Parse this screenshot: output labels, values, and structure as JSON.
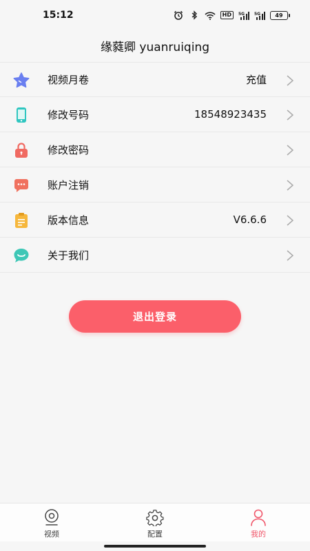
{
  "status_bar": {
    "time": "15:12",
    "icons": [
      "alarm-icon",
      "bluetooth-icon",
      "wifi-icon",
      "hd-icon",
      "signal-5g-icon",
      "signal-5g-icon-2",
      "battery-icon"
    ],
    "hd_label": "HD",
    "battery_level": "49"
  },
  "profile": {
    "display_name": "缘蕤卿 yuanruiqing"
  },
  "menu": {
    "items": [
      {
        "label": "视频月卷",
        "value": "充值",
        "icon": "star-icon",
        "color": "#6a7ff0"
      },
      {
        "label": "修改号码",
        "value": "18548923435",
        "icon": "phone-icon",
        "color": "#2fc6c0"
      },
      {
        "label": "修改密码",
        "value": "",
        "icon": "lock-icon",
        "color": "#f06a62"
      },
      {
        "label": "账户注销",
        "value": "",
        "icon": "chat-bubble-icon",
        "color": "#f0715f"
      },
      {
        "label": "版本信息",
        "value": "V6.6.6",
        "icon": "clipboard-icon",
        "color": "#f6b73c"
      },
      {
        "label": "关于我们",
        "value": "",
        "icon": "smile-bubble-icon",
        "color": "#3ec7b6"
      }
    ]
  },
  "logout": {
    "label": "退出登录",
    "color": "#fb5f6a"
  },
  "tab_bar": {
    "tabs": [
      {
        "label": "视频",
        "icon": "camera-icon",
        "active": false
      },
      {
        "label": "配置",
        "icon": "gear-icon",
        "active": false
      },
      {
        "label": "我的",
        "icon": "person-icon",
        "active": true
      }
    ],
    "active_color": "#f0566a"
  }
}
